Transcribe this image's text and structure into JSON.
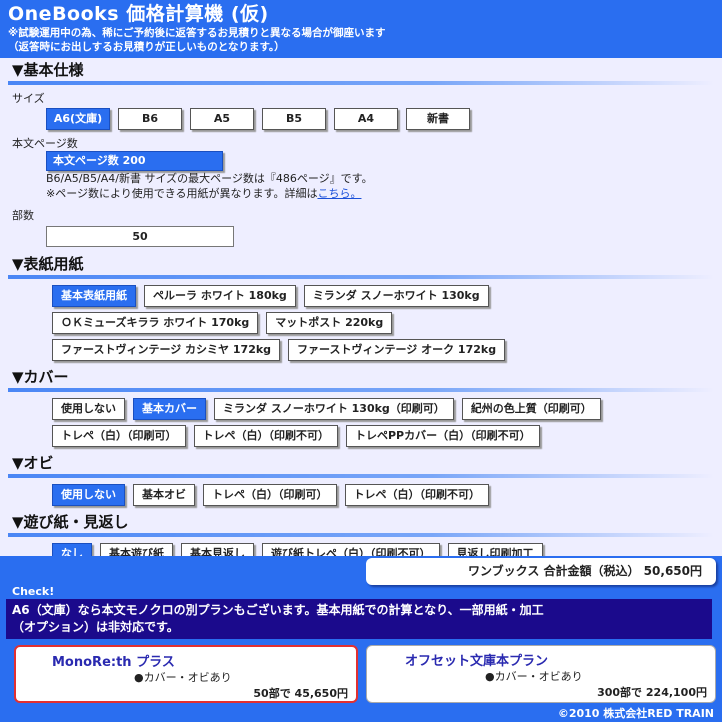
{
  "header": {
    "title": "OneBooks 価格計算機 (仮)",
    "note1": "※試験運用中の為、稀にご予約後に返答するお見積りと異なる場合が御座います",
    "note2": "（返答時にお出しするお見積りが正しいものとなります。）"
  },
  "basic": {
    "heading": "▼基本仕様",
    "size_label": "サイズ",
    "sizes": [
      "A6(文庫)",
      "B6",
      "A5",
      "B5",
      "A4",
      "新書"
    ],
    "pages_label": "本文ページ数",
    "pages_value": "本文ページ数 200",
    "info1": "B6/A5/B5/A4/新書 サイズの最大ページ数は『486ページ』です。",
    "info2": "※ページ数により使用できる用紙が異なります。詳細は",
    "info_link": "こちら。",
    "qty_label": "部数",
    "qty_value": "50"
  },
  "cover_paper": {
    "heading": "▼表紙用紙",
    "row1": [
      "基本表紙用紙",
      "ペルーラ ホワイト 180kg",
      "ミランダ スノーホワイト 130kg"
    ],
    "row2": [
      "ＯＫミューズキララ ホワイト 170kg",
      "マットポスト 220kg"
    ],
    "row3": [
      "ファーストヴィンテージ カシミヤ 172kg",
      "ファーストヴィンテージ オーク 172kg"
    ]
  },
  "cover": {
    "heading": "▼カバー",
    "row1": [
      "使用しない",
      "基本カバー",
      "ミランダ スノーホワイト 130kg（印刷可）",
      "紀州の色上質（印刷可）"
    ],
    "row2": [
      "トレペ（白）（印刷可）",
      "トレペ（白）（印刷不可）",
      "トレペPPカバー（白）（印刷不可）"
    ]
  },
  "obi": {
    "heading": "▼オビ",
    "row1": [
      "使用しない",
      "基本オビ",
      "トレペ（白）（印刷可）",
      "トレペ（白）（印刷不可）"
    ]
  },
  "endpaper": {
    "heading": "▼遊び紙・見返し",
    "row1": [
      "なし",
      "基本遊び紙",
      "基本見返し",
      "遊び紙トレペ（白）（印刷不可）",
      "見返し印刷加工"
    ]
  },
  "summary": {
    "total": "ワンブックス 合計金額（税込） 50,650円",
    "check_badge": "Check!",
    "check_line1": "A6（文庫）なら本文モノクロの別プランもございます。基本用紙での計算となり、一部用紙・加工",
    "check_line2": "（オプション）は非対応です。",
    "plan_left": {
      "title": "MonoRe:th プラス",
      "option": "●カバー・オビあり",
      "price": "50部で 45,650円"
    },
    "plan_right": {
      "title": "オフセット文庫本プラン",
      "option": "●カバー・オビあり",
      "price": "300部で 224,100円"
    },
    "footer": "©2010 株式会社RED TRAIN"
  },
  "colors": {
    "accent": "#2a6ef0",
    "check_box": "#1b0a8c",
    "highlight_border": "#e23030"
  }
}
